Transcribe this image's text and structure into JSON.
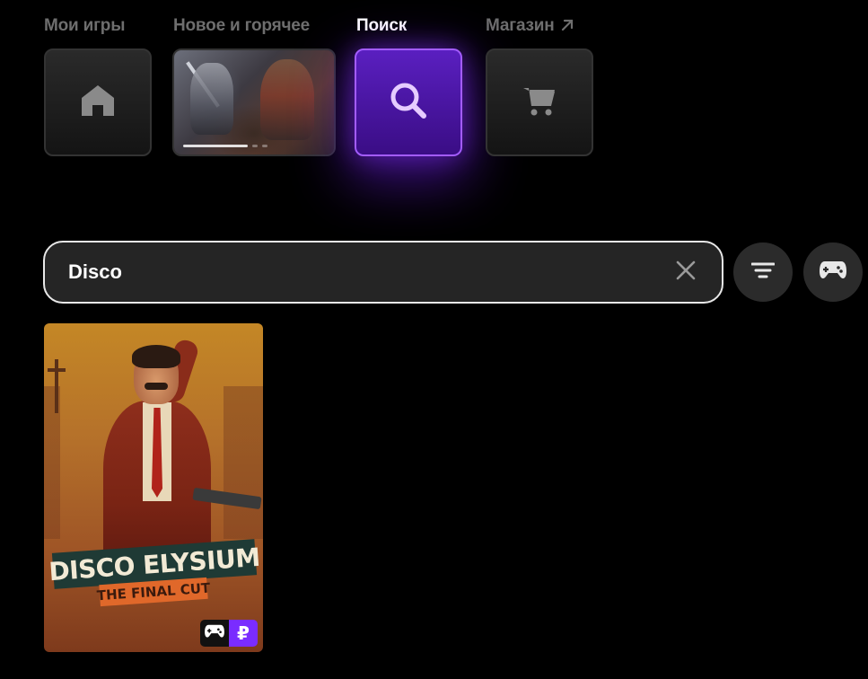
{
  "nav": {
    "my_games": {
      "label": "Мои игры",
      "icon": "home-icon"
    },
    "new_hot": {
      "label": "Новое и горячее"
    },
    "search": {
      "label": "Поиск",
      "icon": "search-icon"
    },
    "store": {
      "label": "Магазин",
      "icon": "cart-icon",
      "external_icon": "arrow-up-right-icon"
    }
  },
  "search": {
    "query": "Disco",
    "clear_icon": "close-icon",
    "filter_icon": "filter-icon",
    "gamepad_icon": "gamepad-icon"
  },
  "results": [
    {
      "title_line1": "DISCO ELYSIUM",
      "title_line2": "THE FINAL CUT",
      "badges": {
        "controller_icon": "gamepad-icon",
        "price_symbol": "₽"
      }
    }
  ],
  "colors": {
    "accent": "#7a2cff",
    "background": "#000000",
    "inactive_label": "#6e6e6e"
  }
}
